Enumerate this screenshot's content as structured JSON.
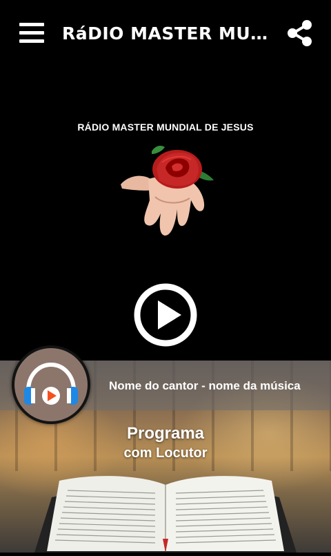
{
  "header": {
    "title": "RáDIO MASTER MUNDI...",
    "menu_icon": "hamburger-menu-icon",
    "share_icon": "share-icon"
  },
  "station": {
    "logo_caption": "RÁDIO MASTER MUNDIAL DE JESUS",
    "logo_image": "hand-holding-red-rose"
  },
  "player": {
    "play_icon": "play-icon",
    "now_playing": "Nome do cantor - nome da música",
    "cover_icon": "headphones-play-icon"
  },
  "program": {
    "title": "Programa",
    "host": "com Locutor"
  },
  "colors": {
    "background": "#000000",
    "text": "#ffffff",
    "cover_bg": "#8c766b",
    "headphone_blue": "#1e88e5",
    "play_orange": "#f4511e"
  }
}
